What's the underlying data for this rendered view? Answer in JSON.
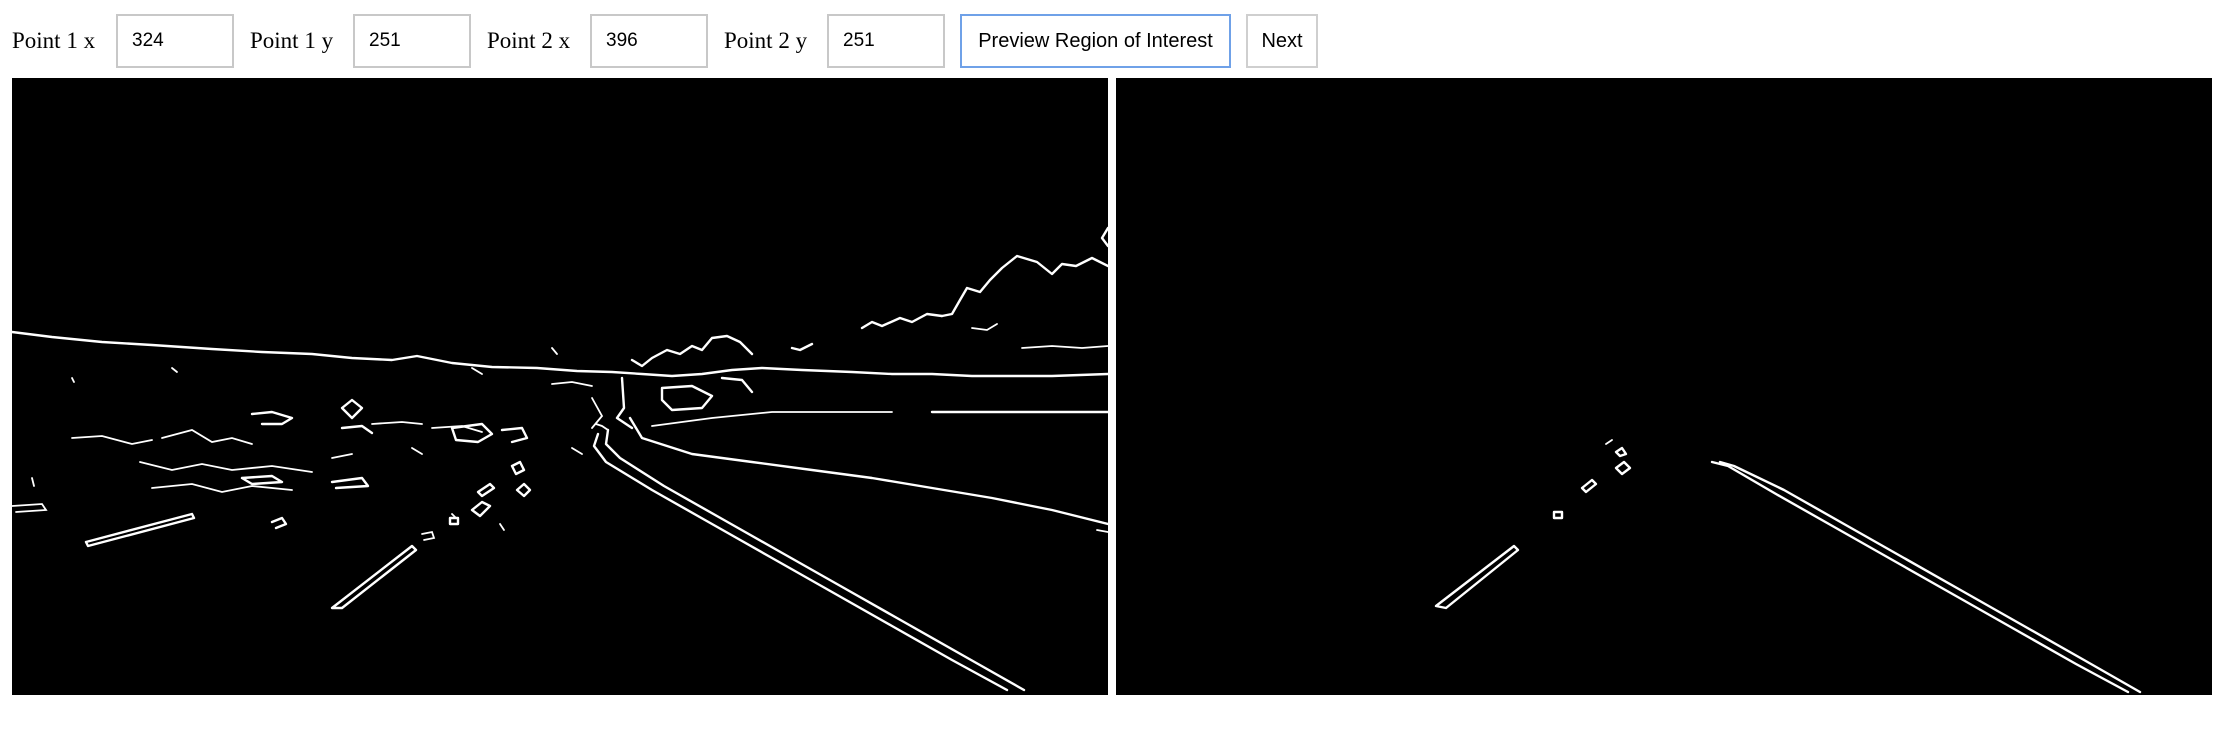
{
  "controls": {
    "point1_x": {
      "label": "Point 1 x",
      "value": "324"
    },
    "point1_y": {
      "label": "Point 1 y",
      "value": "251"
    },
    "point2_x": {
      "label": "Point 2 x",
      "value": "396"
    },
    "point2_y": {
      "label": "Point 2 y",
      "value": "251"
    },
    "preview_button": "Preview Region of Interest",
    "next_button": "Next"
  },
  "panels": {
    "left": {
      "content": "canny-edge-detection-output"
    },
    "right": {
      "content": "region-of-interest-masked-edges"
    }
  },
  "colors": {
    "canvas_background": "#000000",
    "edge_color": "#ffffff",
    "focused_border": "#6fa1e8",
    "input_border": "#c8c8c8"
  }
}
